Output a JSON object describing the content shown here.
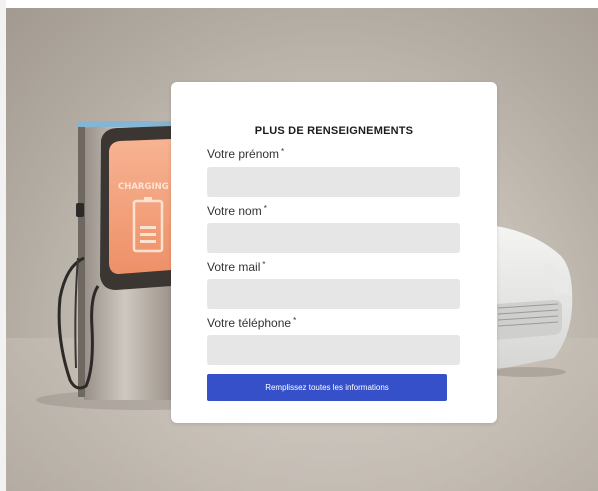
{
  "form": {
    "title": "PLUS DE RENSEIGNEMENTS",
    "required_marker": "*",
    "fields": [
      {
        "label": "Votre prénom",
        "value": "",
        "placeholder": ""
      },
      {
        "label": "Votre nom",
        "value": "",
        "placeholder": ""
      },
      {
        "label": "Votre mail",
        "value": "",
        "placeholder": ""
      },
      {
        "label": "Votre téléphone",
        "value": "",
        "placeholder": ""
      }
    ],
    "submit_label": "Remplissez toutes les informations"
  },
  "background": {
    "charger_screen_text": "CHARGING"
  },
  "colors": {
    "button": "#3650c9",
    "input_bg": "#e6e6e6",
    "card_bg": "#ffffff",
    "screen_glow": "#f0a07a"
  }
}
